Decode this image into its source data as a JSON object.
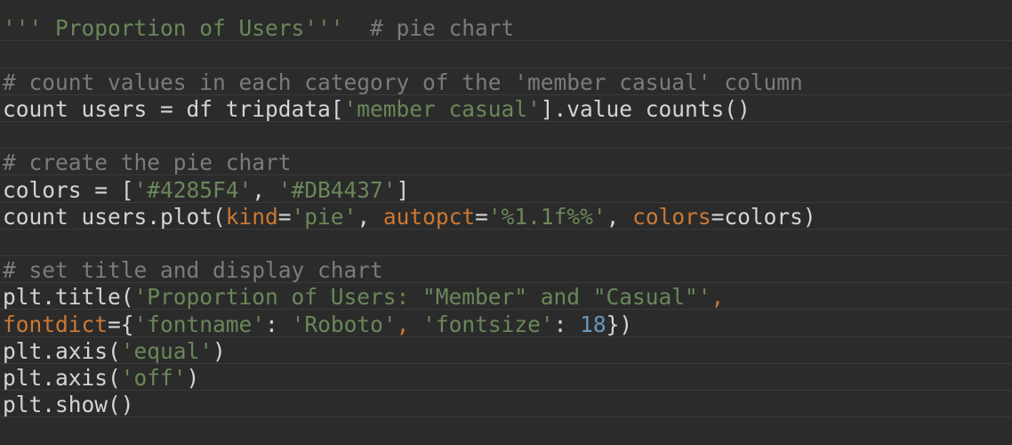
{
  "code": {
    "line1": {
      "docstring": "''' Proportion of Users'''",
      "comment": "  # pie chart"
    },
    "line2": {
      "comment": "# count values in each category of the 'member_casual' column"
    },
    "line3": {
      "a": "count_users = df_tripdata[",
      "b": "'member_casual'",
      "c": "].value_counts()"
    },
    "line4": {
      "comment": "# create the pie chart"
    },
    "line5": {
      "a": "colors = [",
      "b": "'#4285F4'",
      "c": ", ",
      "d": "'#DB4437'",
      "e": "]"
    },
    "line6": {
      "a": "count_users.plot(",
      "b": "kind",
      "c": "=",
      "d": "'pie'",
      "e": ", ",
      "f": "autopct",
      "g": "=",
      "h": "'%1.1f%%'",
      "i": ", ",
      "j": "colors",
      "k": "=colors)"
    },
    "line7": {
      "comment": "# set title and display chart"
    },
    "line8": {
      "a": "plt.title(",
      "b": "'Proportion of Users: \"Member\" and \"Casual\"'",
      "c": ","
    },
    "line9": {
      "a": "fontdict",
      "b": "={",
      "c": "'fontname'",
      "d": ": ",
      "e": "'Roboto'",
      "f": ", ",
      "g": "'fontsize'",
      "h": ": ",
      "i": "18",
      "j": "})"
    },
    "line10": {
      "a": "plt.axis(",
      "b": "'equal'",
      "c": ")"
    },
    "line11": {
      "a": "plt.axis(",
      "b": "'off'",
      "c": ")"
    },
    "line12": {
      "a": "plt.show()"
    }
  },
  "colors": {
    "background": "#2b2b2b",
    "comment": "#7b7b7b",
    "string": "#6a8759",
    "keyword_arg": "#cc7832",
    "number": "#6897bb",
    "text": "#d4d4d4"
  }
}
